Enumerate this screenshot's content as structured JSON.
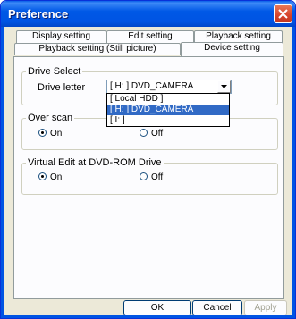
{
  "window": {
    "title": "Preference"
  },
  "tabs": {
    "row_back": [
      "Display setting",
      "Edit setting",
      "Playback setting"
    ],
    "row_front": [
      "Playback setting (Still picture)",
      "Device setting"
    ],
    "active": "Device setting"
  },
  "drive_select": {
    "legend": "Drive Select",
    "drive_letter_label": "Drive letter",
    "selected": "[ H: ] DVD_CAMERA",
    "options": [
      "[ Local HDD ]",
      "[ H: ] DVD_CAMERA",
      "[ I: ]"
    ]
  },
  "over_scan": {
    "legend": "Over scan",
    "on_label": "On",
    "off_label": "Off",
    "value": "On"
  },
  "virtual_edit": {
    "legend": "Virtual Edit at DVD-ROM Drive",
    "on_label": "On",
    "off_label": "Off",
    "value": "On"
  },
  "buttons": {
    "ok": "OK",
    "cancel": "Cancel",
    "apply": "Apply"
  }
}
